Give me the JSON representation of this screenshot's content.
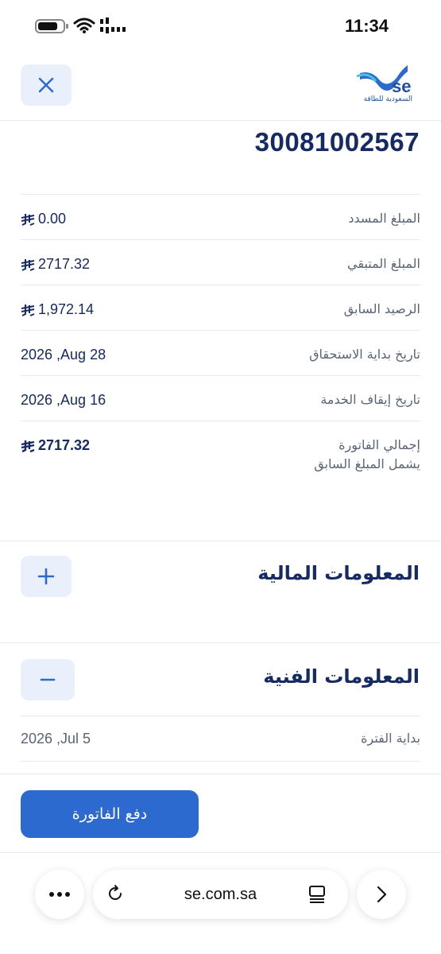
{
  "status_bar": {
    "time": "11:34",
    "battery_level": 0.8
  },
  "header": {
    "logo_text": "السعودية للطاقة",
    "logo_mark": "se"
  },
  "account": {
    "number": "30081002567"
  },
  "bill_rows": [
    {
      "label": "المبلغ المسدد",
      "value": "0.00",
      "currency": true
    },
    {
      "label": "المبلغ المتبقي",
      "value": "2717.32",
      "currency": true
    },
    {
      "label": "الرصيد السابق",
      "value": "1,972.14",
      "currency": true
    },
    {
      "label": "تاريخ بداية الاستحقاق",
      "value": "2026 ,Aug 28",
      "currency": false
    },
    {
      "label": "تاريخ إيقاف الخدمة",
      "value": "2026 ,Aug 16",
      "currency": false
    }
  ],
  "total": {
    "label": "إجمالي الفاتورة",
    "sublabel": "يشمل المبلغ السابق",
    "value": "2717.32"
  },
  "sections": {
    "financial": {
      "title": "المعلومات المالية",
      "expanded": false
    },
    "technical": {
      "title": "المعلومات الفنية",
      "expanded": true
    }
  },
  "technical_rows": [
    {
      "label": "بداية الفترة",
      "value": "2026 ,Jul 5"
    }
  ],
  "actions": {
    "pay_label": "دفع الفاتورة"
  },
  "browser": {
    "url": "se.com.sa"
  },
  "colors": {
    "primary": "#2c6ad0",
    "navy": "#162a63",
    "button_bg": "#e9f0fb"
  }
}
